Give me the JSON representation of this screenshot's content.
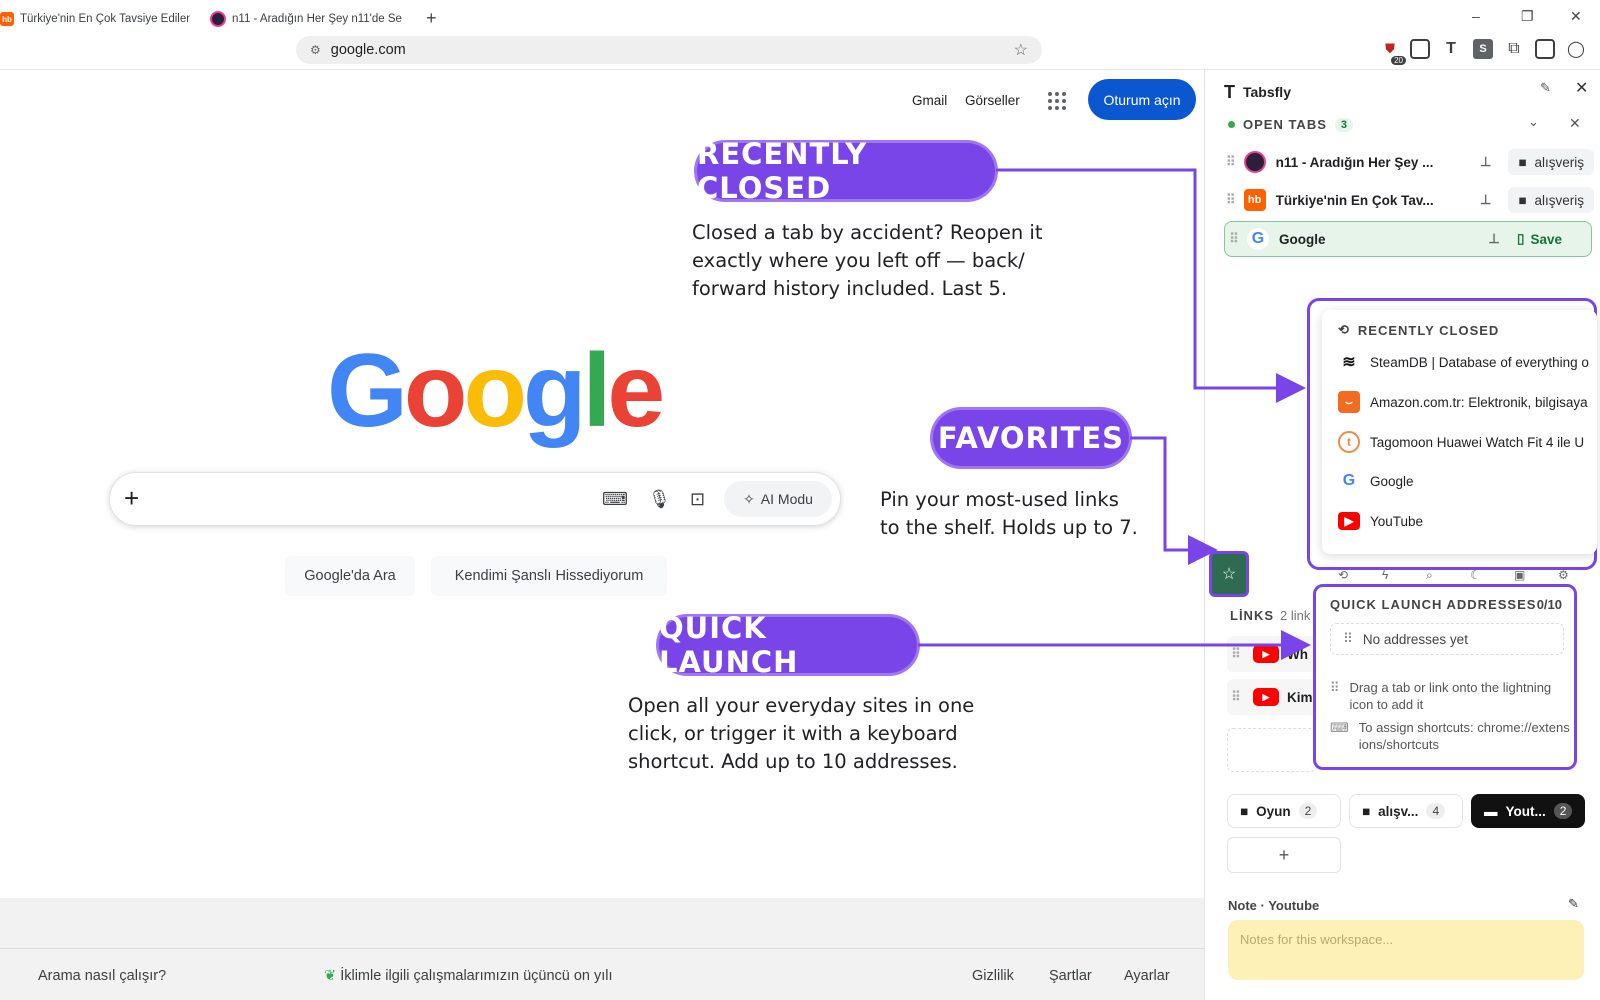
{
  "browser": {
    "tabs": [
      {
        "title": "Türkiye'nin En Çok Tavsiye Edilen",
        "favicon": "hb"
      },
      {
        "title": "n11 - Aradığın Her Şey n11'de Se",
        "favicon": "n11"
      }
    ],
    "new_tab": "+",
    "url": "google.com",
    "window_controls": [
      "–",
      "❐",
      "✕"
    ]
  },
  "google": {
    "top_links": {
      "gmail": "Gmail",
      "images": "Görseller"
    },
    "signin": "Oturum açın",
    "logo": [
      "G",
      "o",
      "o",
      "g",
      "l",
      "e"
    ],
    "logo_colors": [
      "#4285F4",
      "#EA4335",
      "#FBBC05",
      "#4285F4",
      "#34A853",
      "#EA4335"
    ],
    "ai_mode": "AI Modu",
    "buttons": {
      "search": "Google'da Ara",
      "lucky": "Kendimi Şanslı Hissediyorum"
    },
    "footer": {
      "how": "Arama nasıl çalışır?",
      "climate": "İklimle ilgili çalışmalarımızın üçüncü on yılı",
      "privacy": "Gizlilik",
      "terms": "Şartlar",
      "settings": "Ayarlar"
    }
  },
  "callouts": {
    "recently_closed": {
      "title": "RECENTLY CLOSED",
      "text": [
        "Closed a tab by accident? Reopen it",
        "exactly where you left off — back/",
        "forward history included. Last 5."
      ]
    },
    "favorites": {
      "title": "FAVORITES",
      "text": [
        "Pin your most-used links",
        "to the shelf. Holds up to 7."
      ]
    },
    "quick_launch": {
      "title": "QUICK LAUNCH",
      "text": [
        "Open all your everyday sites in one",
        "click, or trigger it with a keyboard",
        "shortcut. Add up to 10 addresses."
      ]
    },
    "accent": "#7a45e8"
  },
  "panel": {
    "title": "Tabsfly",
    "open_tabs": {
      "label": "OPEN TABS",
      "count": "3",
      "items": [
        {
          "title": "n11 - Aradığın Her Şey ...",
          "folder": "alışveriş"
        },
        {
          "title": "Türkiye'nin En Çok Tav...",
          "folder": "alışveriş"
        },
        {
          "title": "Google",
          "action": "Save"
        }
      ]
    },
    "recently_closed": {
      "label": "RECENTLY CLOSED",
      "items": [
        {
          "title": "SteamDB | Database of everything o",
          "icon": "steamdb-icon"
        },
        {
          "title": "Amazon.com.tr: Elektronik, bilgisaya",
          "icon": "amazon-icon"
        },
        {
          "title": "Tagomoon Huawei Watch Fit 4 ile U",
          "icon": "tagomoon-icon"
        },
        {
          "title": "Google",
          "icon": "google-icon"
        },
        {
          "title": "YouTube",
          "icon": "youtube-icon"
        }
      ]
    },
    "quick_launch": {
      "label": "QUICK LAUNCH ADDRESSES",
      "count": "0/10",
      "empty": "No addresses yet",
      "hint_drag": "Drag a tab or link onto the lightning icon to add it",
      "hint_shortcut": "To assign shortcuts: chrome://extensions/shortcuts"
    },
    "links": {
      "label": "LİNKS",
      "count": "2 link",
      "items": [
        "Wh",
        "Kim"
      ]
    },
    "workspaces": [
      {
        "name": "Oyun",
        "count": "2"
      },
      {
        "name": "alışv...",
        "count": "4"
      },
      {
        "name": "Yout...",
        "count": "2",
        "active": true
      }
    ],
    "add_label": "+",
    "note": {
      "title": "Note · Youtube",
      "placeholder": "Notes for this workspace..."
    }
  }
}
